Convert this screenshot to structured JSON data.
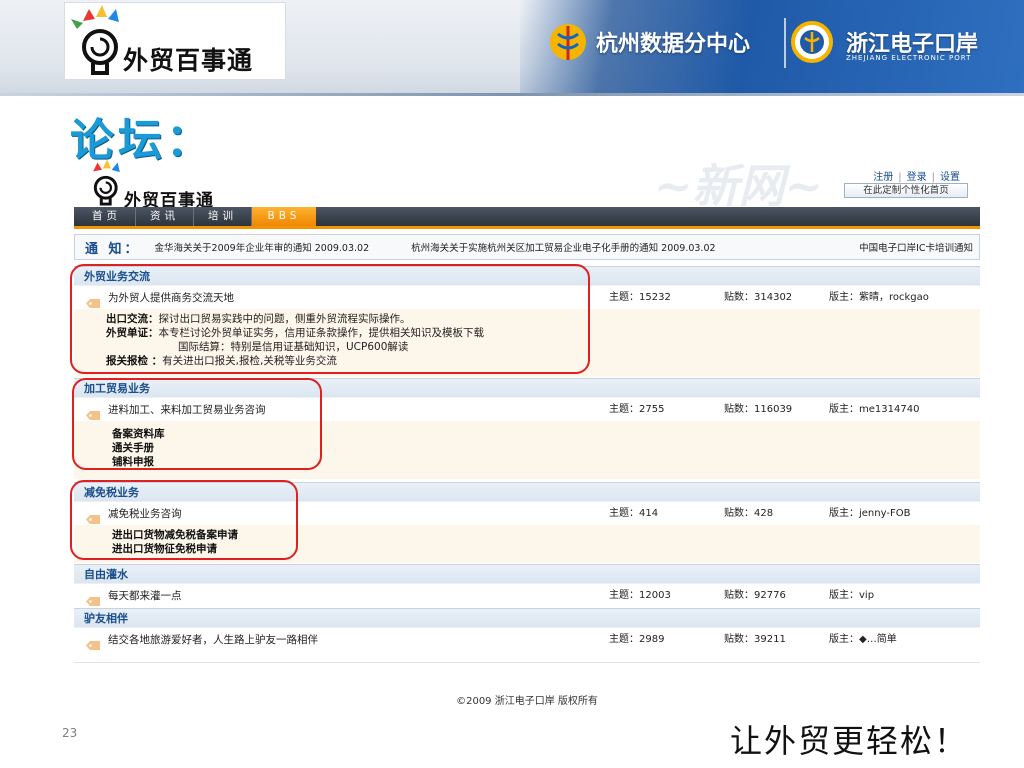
{
  "header": {
    "logo_text": "外贸百事通",
    "partner1": "杭州数据分中心",
    "partner2": "浙江电子口岸",
    "partner2_sub": "ZHEJIANG ELECTRONIC PORT"
  },
  "slide": {
    "title": "论坛：",
    "number": "23",
    "slogan": "让外贸更轻松！"
  },
  "site": {
    "logo_text": "外贸百事通",
    "user_links": [
      "注册",
      "登录",
      "设置"
    ],
    "custom_home": "在此定制个性化首页",
    "nav": [
      "首页",
      "资讯",
      "培训",
      "BBS"
    ],
    "notice": {
      "label": "通 知：",
      "items": [
        "金华海关关于2009年企业年审的通知 2009.03.02",
        "杭州海关关于实施杭州关区加工贸易企业电子化手册的通知  2009.03.02",
        "中国电子口岸IC卡培训通知"
      ]
    },
    "categories": [
      {
        "title": "外贸业务交流",
        "forum": "为外贸人提供商务交流天地",
        "topics": "主题：15232",
        "posts": "贴数：314302",
        "mods": "版主：紫晴，rockgao",
        "subs": [
          {
            "name": "出口交流：",
            "desc": "探讨出口贸易实践中的问题，侧重外贸流程实际操作。"
          },
          {
            "name": "外贸单证：",
            "desc": "本专栏讨论外贸单证实务，信用证条款操作，提供相关知识及模板下载"
          },
          {
            "name": "",
            "desc": "国际结算：特别是信用证基础知识，UCP600解读"
          },
          {
            "name": "报关报检 ：",
            "desc": "有关进出口报关,报检,关税等业务交流"
          }
        ]
      },
      {
        "title": "加工贸易业务",
        "forum": "进料加工、来料加工贸易业务咨询",
        "topics": "主题：2755",
        "posts": "贴数：116039",
        "mods": "版主：me1314740",
        "subs": [
          {
            "name": "备案资料库"
          },
          {
            "name": "通关手册"
          },
          {
            "name": "铺料申报"
          }
        ]
      },
      {
        "title": "减免税业务",
        "forum": "减免税业务咨询",
        "topics": "主题：414",
        "posts": "贴数：428",
        "mods": "版主：jenny-FOB",
        "subs": [
          {
            "name": "进出口货物减免税备案申请"
          },
          {
            "name": "进出口货物征免税申请"
          }
        ]
      },
      {
        "title": "自由灌水",
        "forum": "每天都来灌一点",
        "topics": "主题：12003",
        "posts": "贴数：92776",
        "mods": "版主：vip"
      },
      {
        "title": "驴友相伴",
        "forum": "结交各地旅游爱好者，人生路上驴友一路相伴",
        "topics": "主题：2989",
        "posts": "贴数：39211",
        "mods": "版主：◆…简单"
      }
    ],
    "copyright": "©2009 浙江电子口岸 版权所有"
  },
  "colors": {
    "title_blue": "#1a9ad6",
    "nav_active": "#f08700",
    "highlight_circle": "#e02020",
    "category_text": "#1a4e8c"
  }
}
